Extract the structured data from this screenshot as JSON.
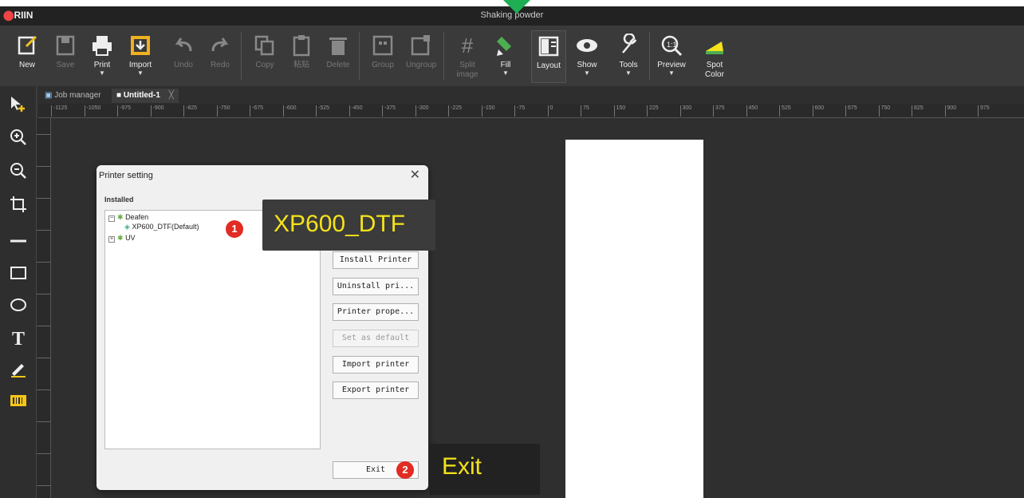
{
  "app": {
    "logo_prefix": "⬤",
    "logo_text": "RIIN",
    "window_title": "Shaking powder"
  },
  "toolbar": {
    "new": "New",
    "save": "Save",
    "print": "Print",
    "import": "Import",
    "undo": "Undo",
    "redo": "Redo",
    "copy": "Copy",
    "copy2": "粘贴",
    "delete": "Delete",
    "group": "Group",
    "ungroup": "Ungroup",
    "split_image_1": "Split",
    "split_image_2": "image",
    "fill": "Fill",
    "layout": "Layout",
    "show": "Show",
    "tools": "Tools",
    "preview": "Preview",
    "spot_color_1": "Spot",
    "spot_color_2": "Color"
  },
  "tabs": {
    "job_manager": "Job manager",
    "untitled": "Untitled-1",
    "close": "╳"
  },
  "ruler": {
    "ticks": [
      "-1125",
      "-1050",
      "-975",
      "-900",
      "-825",
      "-750",
      "-675",
      "-600",
      "-525",
      "-450",
      "-375",
      "-300",
      "-225",
      "-150",
      "-75",
      "0",
      "75",
      "150",
      "225",
      "300",
      "375",
      "450",
      "525",
      "600",
      "675",
      "750",
      "825",
      "900",
      "975"
    ]
  },
  "dialog": {
    "title": "Printer setting",
    "close": "✕",
    "installed_label": "Installed",
    "tree": {
      "group1": "Deafen",
      "printer": "XP600_DTF(Default)",
      "group2": "UV"
    },
    "buttons": {
      "install": "Install Printer",
      "uninstall": "Uninstall pri...",
      "properties": "Printer prope...",
      "set_default": "Set as default",
      "import": "Import printer",
      "export": "Export printer",
      "exit": "Exit"
    }
  },
  "callouts": {
    "step1_badge": "1",
    "step1_text": "XP600_DTF",
    "step2_badge": "2",
    "step2_text": "Exit"
  },
  "colors": {
    "callout_text": "#f5e21a",
    "badge": "#e12b23",
    "marker": "#1fae54"
  }
}
